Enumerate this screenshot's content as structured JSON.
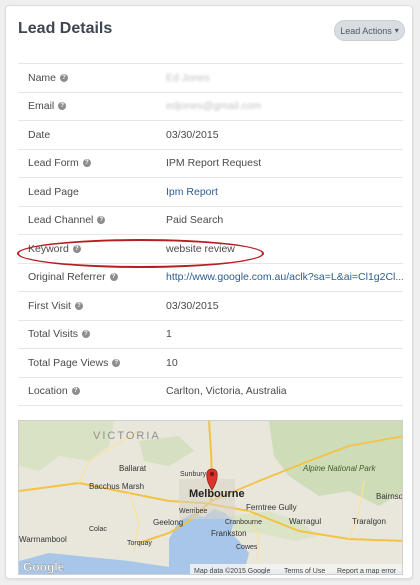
{
  "header": {
    "title": "Lead Details",
    "actions_label": "Lead Actions",
    "actions_caret": "▾"
  },
  "rows": [
    {
      "label": "Name",
      "help": true,
      "value": "Ed Jones",
      "redacted": true
    },
    {
      "label": "Email",
      "help": true,
      "value": "edjones@gmail.com",
      "redacted": true
    },
    {
      "label": "Date",
      "help": false,
      "value": "03/30/2015"
    },
    {
      "label": "Lead Form",
      "help": true,
      "value": "IPM Report Request"
    },
    {
      "label": "Lead Page",
      "help": false,
      "value": "Ipm Report",
      "link": true
    },
    {
      "label": "Lead Channel",
      "help": true,
      "value": "Paid Search"
    },
    {
      "label": "Keyword",
      "help": true,
      "value": "website review"
    },
    {
      "label": "Original Referrer",
      "help": true,
      "value": "http://www.google.com.au/aclk?sa=L&ai=Cl1g2Cl...",
      "link": true
    },
    {
      "label": "First Visit",
      "help": true,
      "value": "03/30/2015"
    },
    {
      "label": "Total Visits",
      "help": true,
      "value": "1"
    },
    {
      "label": "Total Page Views",
      "help": true,
      "value": "10"
    },
    {
      "label": "Location",
      "help": true,
      "value": "Carlton, Victoria, Australia"
    }
  ],
  "map": {
    "region_label": "VICTORIA",
    "places": {
      "ballarat": "Ballarat",
      "bacchus_marsh": "Bacchus Marsh",
      "sunbury": "Sunbury",
      "melbourne": "Melbourne",
      "werribee": "Werribee",
      "ferntree_gully": "Ferntree Gully",
      "geelong": "Geelong",
      "cranbourne": "Cranbourne",
      "warragul": "Warragul",
      "traralgon": "Traralgon",
      "frankston": "Frankston",
      "cowes": "Cowes",
      "alpine_national_park": "Alpine National Park",
      "bairnsdale": "Bairnsdale",
      "warrnambool": "Warrnambool",
      "torquay": "Torquay",
      "colac": "Colac"
    },
    "google_logo": "Google",
    "attribution": {
      "data": "Map data ©2015 Google",
      "terms": "Terms of Use",
      "report": "Report a map error"
    },
    "colors": {
      "land": "#e9e6dc",
      "green": "#cfdcb8",
      "water": "#a8c7e8",
      "road_major": "#f4c244",
      "pin": "#d9332c"
    }
  }
}
